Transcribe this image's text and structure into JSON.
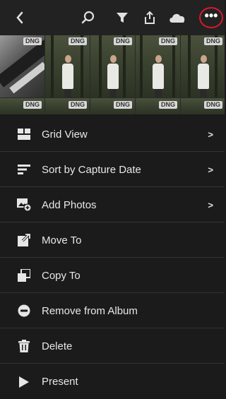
{
  "toolbar": {
    "back_icon": "chevron-left-icon",
    "search_icon": "search-icon",
    "filter_icon": "filter-icon",
    "share_icon": "share-icon",
    "cloud_icon": "cloud-icon",
    "more_icon": "more-icon",
    "more_label": "•••",
    "highlight_color": "#d8192b"
  },
  "thumbnails": {
    "top_row": [
      {
        "badge": "DNG"
      },
      {
        "badge": "DNG"
      },
      {
        "badge": "DNG"
      },
      {
        "badge": "DNG"
      },
      {
        "badge": "DNG"
      }
    ],
    "bottom_row": [
      {
        "badge": "DNG"
      },
      {
        "badge": "DNG"
      },
      {
        "badge": "DNG"
      },
      {
        "badge": "DNG"
      },
      {
        "badge": "DNG"
      }
    ]
  },
  "menu": {
    "items": [
      {
        "label": "Grid View",
        "icon": "grid-view-icon",
        "has_chevron": true
      },
      {
        "label": "Sort by Capture Date",
        "icon": "sort-icon",
        "has_chevron": true
      },
      {
        "label": "Add Photos",
        "icon": "add-photos-icon",
        "has_chevron": true
      },
      {
        "label": "Move To",
        "icon": "move-to-icon",
        "has_chevron": false
      },
      {
        "label": "Copy To",
        "icon": "copy-to-icon",
        "has_chevron": false
      },
      {
        "label": "Remove from Album",
        "icon": "remove-icon",
        "has_chevron": false
      },
      {
        "label": "Delete",
        "icon": "trash-icon",
        "has_chevron": false
      },
      {
        "label": "Present",
        "icon": "play-icon",
        "has_chevron": false
      }
    ],
    "chevron_glyph": ">"
  }
}
